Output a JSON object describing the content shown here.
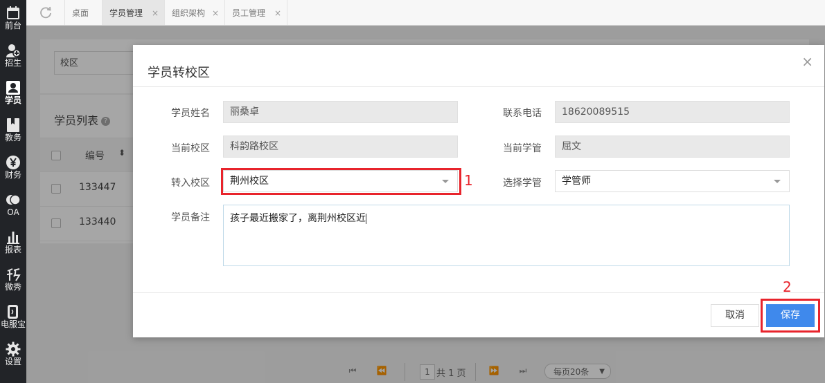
{
  "sidebar": {
    "items": [
      {
        "label": "前台",
        "icon": "calendar-icon"
      },
      {
        "label": "招生",
        "icon": "add-user-icon"
      },
      {
        "label": "学员",
        "icon": "student-icon"
      },
      {
        "label": "教务",
        "icon": "book-icon"
      },
      {
        "label": "财务",
        "icon": "yen-icon"
      },
      {
        "label": "OA",
        "icon": "chat-icon"
      },
      {
        "label": "报表",
        "icon": "bar-chart-icon"
      },
      {
        "label": "微秀",
        "icon": "xiu-icon"
      },
      {
        "label": "电服宝",
        "icon": "phone-service-icon"
      },
      {
        "label": "设置",
        "icon": "gear-icon"
      }
    ],
    "active_index": 2
  },
  "tabs": [
    {
      "label": "桌面",
      "closable": false
    },
    {
      "label": "学员管理",
      "closable": true,
      "active": true
    },
    {
      "label": "组织架构",
      "closable": true
    },
    {
      "label": "员工管理",
      "closable": true
    }
  ],
  "tab_close_glyph": "×",
  "background": {
    "campus_select": "校区",
    "list_title": "学员列表",
    "help_glyph": "?",
    "column_id": "编号",
    "rows": [
      {
        "id": "133447"
      },
      {
        "id": "133440"
      }
    ],
    "pager": {
      "page": "1",
      "total": "共 1 页",
      "page_size": "每页20条"
    }
  },
  "modal": {
    "title": "学员转校区",
    "close_glyph": "×",
    "fields": {
      "student_name_label": "学员姓名",
      "student_name": "丽桑卓",
      "phone_label": "联系电话",
      "phone": "18620089515",
      "current_campus_label": "当前校区",
      "current_campus": "科韵路校区",
      "current_manager_label": "当前学管",
      "current_manager": "屈文",
      "target_campus_label": "转入校区",
      "target_campus": "荆州校区",
      "select_manager_label": "选择学管",
      "select_manager": "学管师",
      "remark_label": "学员备注",
      "remark": "孩子最近搬家了，离荆州校区近"
    },
    "cancel_label": "取消",
    "save_label": "保存"
  },
  "annotations": {
    "marker_1": "1",
    "marker_2": "2",
    "color": "#e8242c"
  },
  "colors": {
    "primary": "#3f89ec",
    "sidebar_bg": "#222428"
  }
}
